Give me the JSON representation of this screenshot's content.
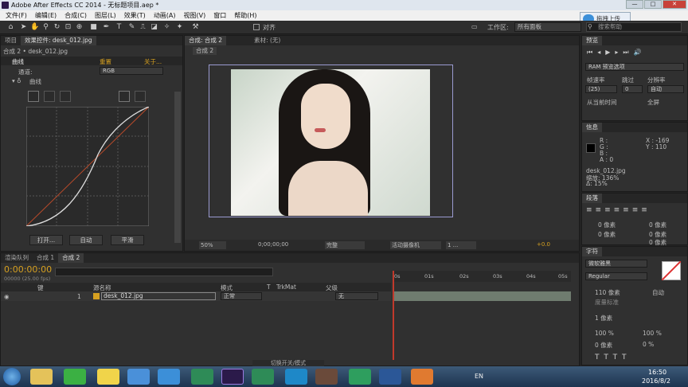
{
  "window": {
    "title": "Adobe After Effects CC 2014 - 无标题项目.aep *",
    "min": "—",
    "max": "□",
    "close": "✕"
  },
  "menu": [
    "文件(F)",
    "编辑(E)",
    "合成(C)",
    "图层(L)",
    "效果(T)",
    "动画(A)",
    "视图(V)",
    "窗口",
    "帮助(H)"
  ],
  "toolbar": {
    "align_label": "对齐",
    "workspace_label": "工作区:",
    "workspace_value": "所有面板",
    "search_placeholder": "搜索帮助"
  },
  "upload_button": "拖拽上传",
  "effects_panel": {
    "tab_project": "项目",
    "tab_effect": "效果控件: desk_012.jpg",
    "header": "合成 2 • desk_012.jpg",
    "fx_name": "曲线",
    "reset": "重置",
    "about": "关于...",
    "channel_label": "通道:",
    "channel_value": "RGB",
    "curve_label": "曲线",
    "buttons": [
      "打开...",
      "自动",
      "平滑"
    ]
  },
  "comp_panel": {
    "tab_comp": "合成: 合成 2",
    "tab_footage": "素材: (无)",
    "subtab": "合成 2",
    "zoom": "50%",
    "timecode": "0;00;00;00",
    "quality": "完整",
    "camera": "活动摄像机",
    "views": "1 ...",
    "exposure": "+0.0"
  },
  "preview": {
    "title": "预览",
    "ram_label": "RAM 预览选项",
    "framerate_label": "帧速率",
    "skip_label": "跳过",
    "resolution_label": "分辨率",
    "framerate_value": "(25)",
    "skip_value": "0",
    "resolution_value": "自动",
    "from_current": "从当前时间",
    "fullscreen": "全屏"
  },
  "info": {
    "title": "信息",
    "r": "R :",
    "g": "G :",
    "b": "B :",
    "a": "A : 0",
    "x": "X : -169",
    "y": "Y : 110",
    "file": "desk_012.jpg",
    "scale": "缩放: 136%",
    "delta": "Δ: 15%"
  },
  "paragraph": {
    "title": "段落",
    "values": [
      "0 像素",
      "0 像素",
      "0 像素",
      "0 像素",
      "0 像素"
    ]
  },
  "character": {
    "title": "字符",
    "font": "微软雅黑",
    "style": "Regular",
    "size": "110 像素",
    "leading": "自动",
    "tracking_label": "度量标准",
    "stroke": "1 像素",
    "scale_v": "100 %",
    "scale_h": "100 %",
    "baseline": "0 像素",
    "tsume": "0 %"
  },
  "timeline": {
    "tabs": [
      "渲染队列",
      "合成 1",
      "合成 2"
    ],
    "timecode": "0:00:00:00",
    "fps": "00000 (25.00 fps)",
    "col_source": "源名称",
    "col_mode": "模式",
    "col_t": "T",
    "col_trkmat": "TrkMat",
    "col_parent": "父级",
    "col_key": "键",
    "layer_num": "1",
    "layer_name": "desk_012.jpg",
    "layer_mode": "正常",
    "layer_parent": "无",
    "ruler": [
      "0s",
      "01s",
      "02s",
      "03s",
      "04s",
      "05s"
    ],
    "footer": "切换开关/模式"
  },
  "taskbar": {
    "time": "16:50",
    "date": "2016/8/2",
    "lang": "EN"
  },
  "colors": {
    "accent": "#d6a020",
    "panel": "#303030",
    "playhead": "#c0392b"
  }
}
